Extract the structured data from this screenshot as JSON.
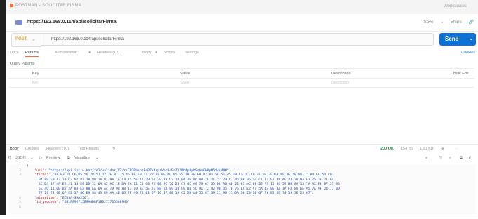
{
  "window": {
    "title_text": "POSTMAN - SOLICITAR FIRMA",
    "workspace_text": "Workspaces"
  },
  "tab": {
    "url_label": "https://192.168.0.114/api/solicitarFirma"
  },
  "tab_actions": {
    "save": "Save",
    "share": "Share"
  },
  "request": {
    "method": "POST",
    "url_value": "https://192.168.0.114/api/solicitarFirma",
    "send_label": "Send"
  },
  "request_tabs": {
    "docs": "Docs",
    "params": "Params",
    "authorization": "Authorization",
    "headers": "Headers (12)",
    "body": "Body",
    "scripts": "Scripts",
    "settings": "Settings",
    "cookies": "Cookies"
  },
  "query_params": {
    "title": "Query Params",
    "columns": {
      "key": "Key",
      "value": "Value",
      "description": "Description",
      "bulk_edit": "Bulk Edit"
    },
    "placeholders": {
      "key": "Key",
      "value": "Value",
      "description": "Description"
    }
  },
  "response": {
    "tabs": {
      "body": "Body",
      "cookies": "Cookies",
      "headers": "Headers (10)",
      "test_results": "Test Results"
    },
    "status": "200 OK",
    "time": "154 ms",
    "size": "1.21 KB",
    "view": {
      "format": "JSON",
      "preview": "Preview",
      "visualize": "Visualize"
    }
  },
  "response_body": {
    "line_numbers": [
      "1",
      "2",
      "3",
      "",
      "",
      "",
      "",
      "",
      "4",
      "5",
      "6"
    ],
    "open_brace": "{",
    "url_key": "\"url\"",
    "url_value": "\"https://api.iot.v.kaz/fe1/validar/VZ/rsCP7RbspsPcPZkdrprVosPcPrZX2Nb4p8pRSsbnKbHpN5d4n4N#\"",
    "firma_key": "\"firma\"",
    "firma_lines": [
      "\"88 83 18 C6 D5 56 7B 51 D2 3E 81 25 45 FE F0 11 22 AF 9E 0D 95 55 29 A6 E8 02 A1 6C 51 85 7B 15 2D 19 7F 0E 79 6B 8F 2E 2B 66 17 A4 FF 5D 7D",
      "B4 89 E9 A3 20 C2 02 87 78 80 1A 01 9A 1A C8 15 5E 17 29 61 29 33 D2 24 6A 76 9D 08 7F 71 22 29 C2 45 9B 76 61 C1 41 97 38 AF 73 39 AA E3 76 3B 21 64",
      "4C D4 17 4F EE 21 14 E9 DD 22 6A 82 AC 1E DA 2A 11 C5 C8 7E 0E 9C 50 23 C7 4C 09 79 67 35 D8 A0 A0 22 37 4C 19 2E 72 13 8E 59 0B 8A 13 7A AC E6 8F 57 93",
      "5E 4C 11 0B 85 2A 88 E3 88 EA 6A A4 79 98 88 13 19 3E 5E 2E 88 2A 89 10 E9 84 5C 91 72 42 9B D5 7B 75 1A E2 71 5A 4E 80 3A 1A FA 89 6E 95 7E 9E 24 77 89",
      "77 29 74 CE 6F E2 37 46 E9 88 43 E9 AA 4B 63 7F 49 76 01 6F 1C 47 08 19 C2 2B 84 55 87 39 21 98 11 DA 60 23 56 6F 78 E3 6E 74 59 3E 23 07\","
    ],
    "algoritmo_key": "\"algoritmo\"",
    "algoritmo_value": "\"ECDSA-SHA256\"",
    "id_proceso_key": "\"id_proceso\"",
    "id_proceso_value": "\"DB1F892715B9A6D8F1B0271765388940\""
  }
}
